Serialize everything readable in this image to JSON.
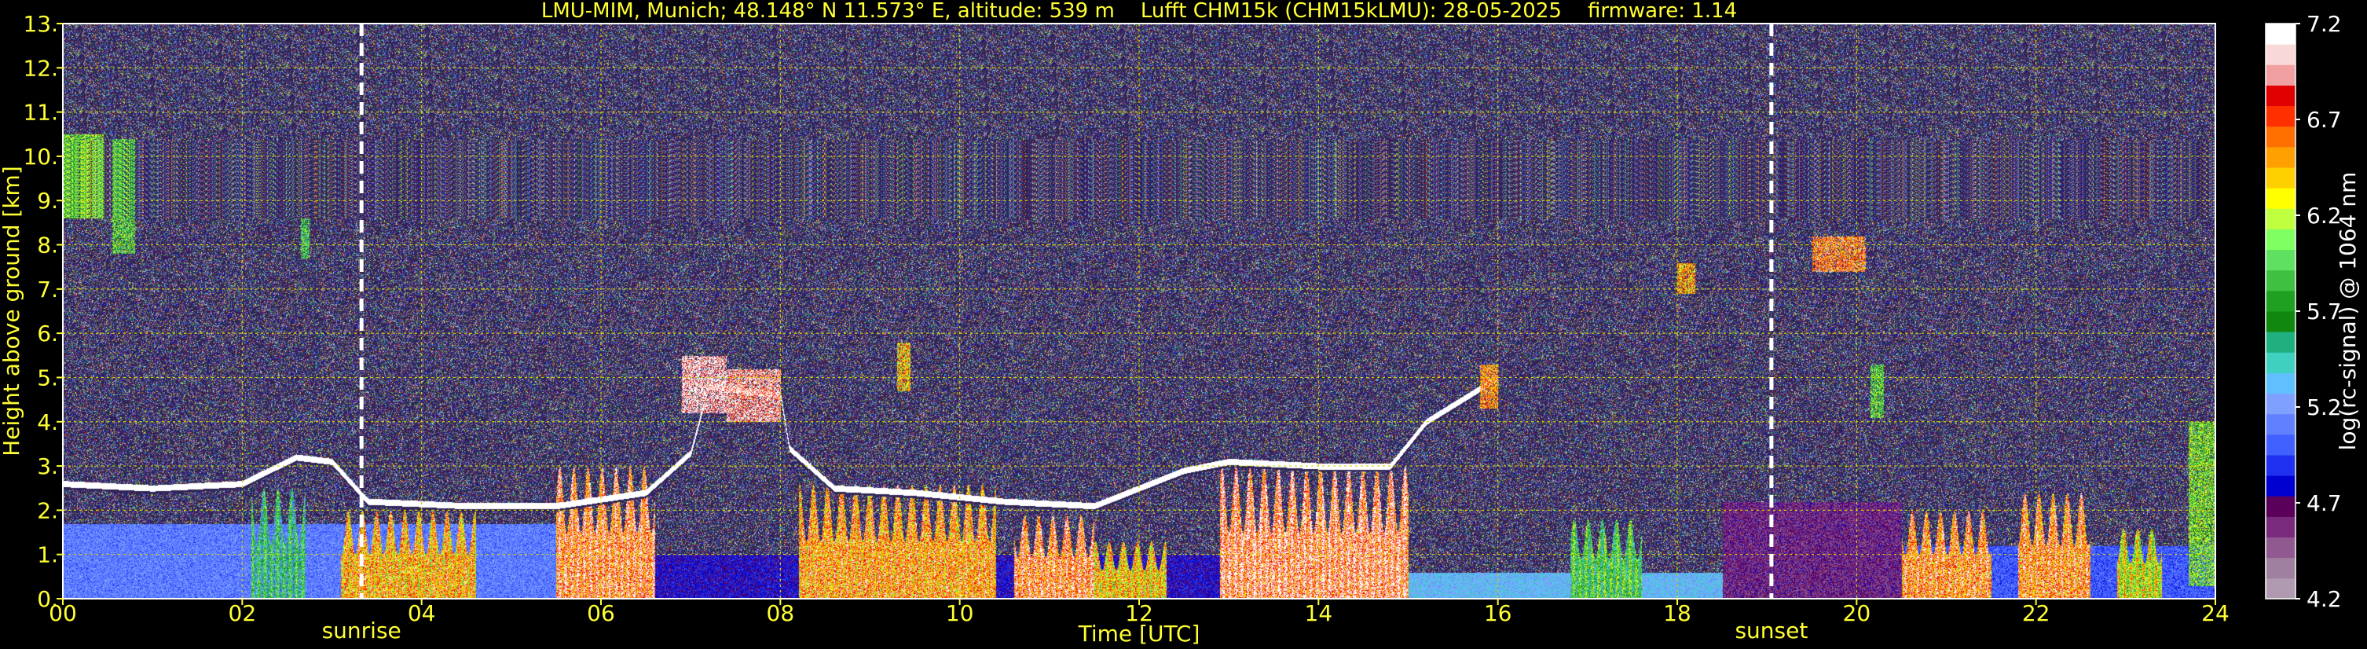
{
  "chart_data": {
    "type": "heatmap",
    "title": "LMU-MIM, Munich; 48.148° N 11.573° E, altitude: 539 m    Lufft CHM15k (CHM15kLMU): 28-05-2025    firmware: 1.14",
    "xlabel": "Time [UTC]",
    "ylabel": "Height above ground [km]",
    "xlim": [
      0,
      24
    ],
    "ylim": [
      0,
      13
    ],
    "x_ticks": [
      "00",
      "02",
      "04",
      "06",
      "08",
      "10",
      "12",
      "14",
      "16",
      "18",
      "20",
      "22",
      "24"
    ],
    "y_ticks": [
      "0.",
      "1.",
      "2.",
      "3.",
      "4.",
      "5.",
      "6.",
      "7.",
      "8.",
      "9.",
      "10.",
      "11.",
      "12.",
      "13."
    ],
    "grid": true,
    "colorbar": {
      "label": "log(rc-signal) @ 1064 nm",
      "range": [
        4.2,
        7.2
      ],
      "ticks": [
        "4.2",
        "4.7",
        "5.2",
        "5.7",
        "6.2",
        "6.7",
        "7.2"
      ],
      "colors": [
        "#b09ab0",
        "#a080a0",
        "#905a90",
        "#7a2a7a",
        "#5a005a",
        "#0000d0",
        "#2030f0",
        "#4060ff",
        "#6080ff",
        "#80a0ff",
        "#60c0ff",
        "#40d0c0",
        "#20b080",
        "#108810",
        "#20a020",
        "#40c040",
        "#60e060",
        "#80ff60",
        "#c0ff40",
        "#ffff00",
        "#ffd000",
        "#ffa000",
        "#ff7000",
        "#ff3000",
        "#e00000",
        "#f0a0a0",
        "#f8d8d8",
        "#ffffff"
      ]
    },
    "markers": [
      {
        "label": "sunrise",
        "x": 3.33
      },
      {
        "label": "sunset",
        "x": 19.05
      }
    ],
    "features": {
      "boundary_layer_top_km": [
        {
          "x": 0.0,
          "y": 2.6
        },
        {
          "x": 1.0,
          "y": 2.5
        },
        {
          "x": 2.0,
          "y": 2.6
        },
        {
          "x": 2.6,
          "y": 3.2
        },
        {
          "x": 3.0,
          "y": 3.1
        },
        {
          "x": 3.4,
          "y": 2.2
        },
        {
          "x": 4.5,
          "y": 2.1
        },
        {
          "x": 5.5,
          "y": 2.1
        },
        {
          "x": 6.5,
          "y": 2.4
        },
        {
          "x": 7.0,
          "y": 3.3
        },
        {
          "x": 7.2,
          "y": 4.8
        },
        {
          "x": 8.0,
          "y": 4.6
        },
        {
          "x": 8.1,
          "y": 3.4
        },
        {
          "x": 8.6,
          "y": 2.5
        },
        {
          "x": 9.5,
          "y": 2.4
        },
        {
          "x": 10.5,
          "y": 2.2
        },
        {
          "x": 11.5,
          "y": 2.1
        },
        {
          "x": 12.5,
          "y": 2.9
        },
        {
          "x": 13.0,
          "y": 3.1
        },
        {
          "x": 14.0,
          "y": 3.0
        },
        {
          "x": 14.8,
          "y": 3.0
        },
        {
          "x": 15.2,
          "y": 4.0
        },
        {
          "x": 16.0,
          "y": 5.0
        }
      ],
      "cloud_patches": [
        {
          "x0": 0.0,
          "x1": 0.45,
          "y0": 8.6,
          "y1": 10.5,
          "v": 6.0
        },
        {
          "x0": 0.55,
          "x1": 0.8,
          "y0": 7.8,
          "y1": 10.4,
          "v": 5.9
        },
        {
          "x0": 2.65,
          "x1": 2.75,
          "y0": 7.7,
          "y1": 8.6,
          "v": 5.8
        },
        {
          "x0": 6.9,
          "x1": 7.4,
          "y0": 4.2,
          "y1": 5.5,
          "v": 7.1
        },
        {
          "x0": 7.4,
          "x1": 8.0,
          "y0": 4.0,
          "y1": 5.2,
          "v": 7.0
        },
        {
          "x0": 9.3,
          "x1": 9.45,
          "y0": 4.7,
          "y1": 5.8,
          "v": 6.4
        },
        {
          "x0": 15.8,
          "x1": 16.0,
          "y0": 4.3,
          "y1": 5.3,
          "v": 6.6
        },
        {
          "x0": 18.0,
          "x1": 18.2,
          "y0": 6.9,
          "y1": 7.6,
          "v": 6.5
        },
        {
          "x0": 19.5,
          "x1": 20.1,
          "y0": 7.4,
          "y1": 8.2,
          "v": 6.7
        },
        {
          "x0": 20.15,
          "x1": 20.3,
          "y0": 4.1,
          "y1": 5.3,
          "v": 5.9
        },
        {
          "x0": 23.7,
          "x1": 24.0,
          "y0": 0.3,
          "y1": 4.0,
          "v": 6.0
        }
      ],
      "intense_columns": [
        {
          "x0": 2.1,
          "x1": 2.7,
          "y1": 2.5,
          "v": 5.6
        },
        {
          "x0": 3.1,
          "x1": 4.6,
          "y1": 2.0,
          "v": 6.5
        },
        {
          "x0": 5.5,
          "x1": 6.6,
          "y1": 3.0,
          "v": 6.8
        },
        {
          "x0": 8.2,
          "x1": 10.4,
          "y1": 2.6,
          "v": 6.6
        },
        {
          "x0": 10.6,
          "x1": 11.5,
          "y1": 1.9,
          "v": 6.8
        },
        {
          "x0": 11.5,
          "x1": 12.3,
          "y1": 1.3,
          "v": 6.4
        },
        {
          "x0": 12.9,
          "x1": 15.0,
          "y1": 3.0,
          "v": 6.9
        },
        {
          "x0": 16.8,
          "x1": 17.6,
          "y1": 1.8,
          "v": 5.8
        },
        {
          "x0": 20.5,
          "x1": 21.5,
          "y1": 2.0,
          "v": 6.7
        },
        {
          "x0": 21.8,
          "x1": 22.6,
          "y1": 2.4,
          "v": 6.7
        },
        {
          "x0": 22.9,
          "x1": 23.4,
          "y1": 1.6,
          "v": 6.2
        }
      ],
      "aerosol_layer": [
        {
          "x0": 0.0,
          "x1": 5.5,
          "y1": 1.7,
          "v": 5.1
        },
        {
          "x0": 5.5,
          "x1": 15.0,
          "y1": 1.0,
          "v": 4.8
        },
        {
          "x0": 15.0,
          "x1": 18.5,
          "y1": 0.6,
          "v": 5.3
        },
        {
          "x0": 18.5,
          "x1": 20.5,
          "y1": 2.2,
          "v": 4.6
        },
        {
          "x0": 20.5,
          "x1": 24.0,
          "y1": 1.2,
          "v": 5.0
        }
      ]
    }
  }
}
